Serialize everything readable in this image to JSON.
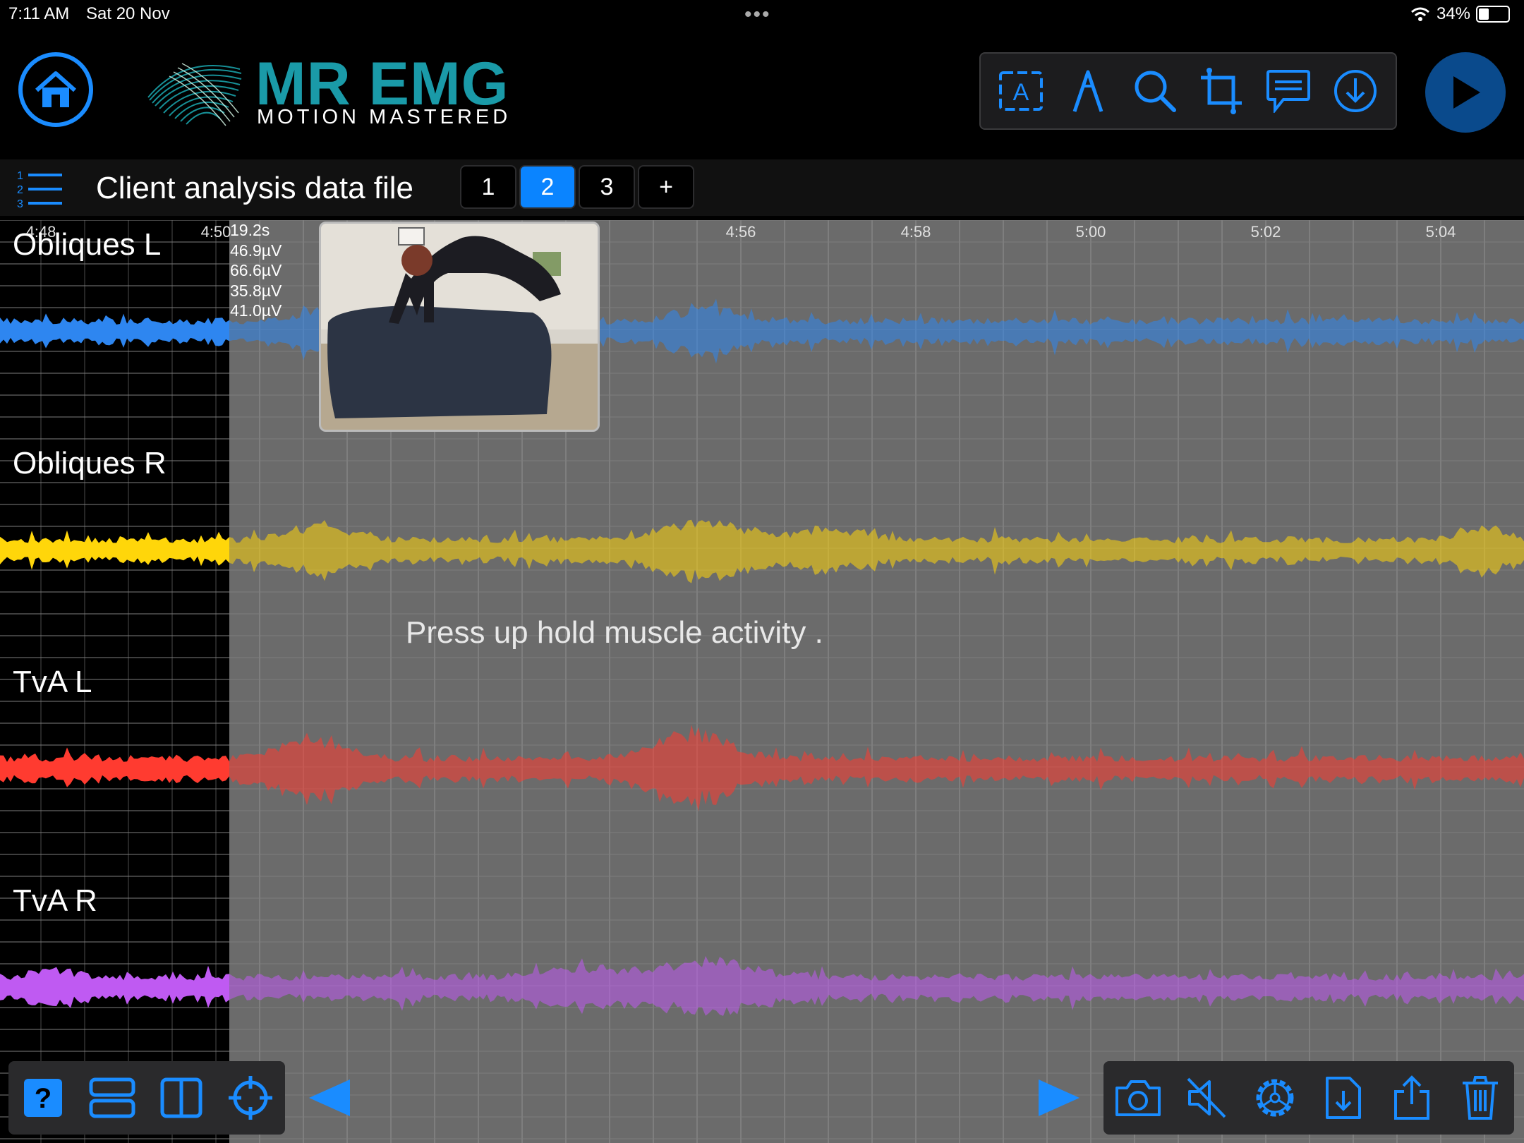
{
  "status_bar": {
    "time": "7:11 AM",
    "date": "Sat 20 Nov",
    "battery_text": "34%",
    "battery_level": 0.34
  },
  "header": {
    "logo_title": "MR EMG",
    "logo_subtitle": "MOTION MASTERED",
    "toolbar_icons": [
      "text-box-icon",
      "pen-icon",
      "search-icon",
      "crop-icon",
      "comment-icon",
      "download-icon"
    ],
    "accent": "#1a8cff",
    "brand_teal": "#1a9aa8"
  },
  "file_bar": {
    "title": "Client analysis data file",
    "tabs": [
      "1",
      "2",
      "3",
      "+"
    ],
    "active_tab": "2"
  },
  "timeline": {
    "ticks": [
      "4:48",
      "4:50",
      "4:56",
      "4:58",
      "5:00",
      "5:02",
      "5:04"
    ]
  },
  "cursor_readout": {
    "time": "19.2s",
    "values": [
      "46.9µV",
      "66.6µV",
      "35.8µV",
      "41.0µV"
    ]
  },
  "channels": [
    {
      "label": "Obliques L",
      "color": "#2e86f0"
    },
    {
      "label": "Obliques R",
      "color": "#ffd60a"
    },
    {
      "label": "TvA L",
      "color": "#ff3b30"
    },
    {
      "label": "TvA R",
      "color": "#bf5af2"
    }
  ],
  "annotation_text": "Press up hold muscle activity .",
  "bottom_left_icons": [
    "help-icon",
    "stack-layout-icon",
    "split-layout-icon",
    "crosshair-icon"
  ],
  "bottom_right_icons": [
    "camera-icon",
    "mute-icon",
    "settings-icon",
    "export-file-icon",
    "share-icon",
    "trash-icon"
  ]
}
